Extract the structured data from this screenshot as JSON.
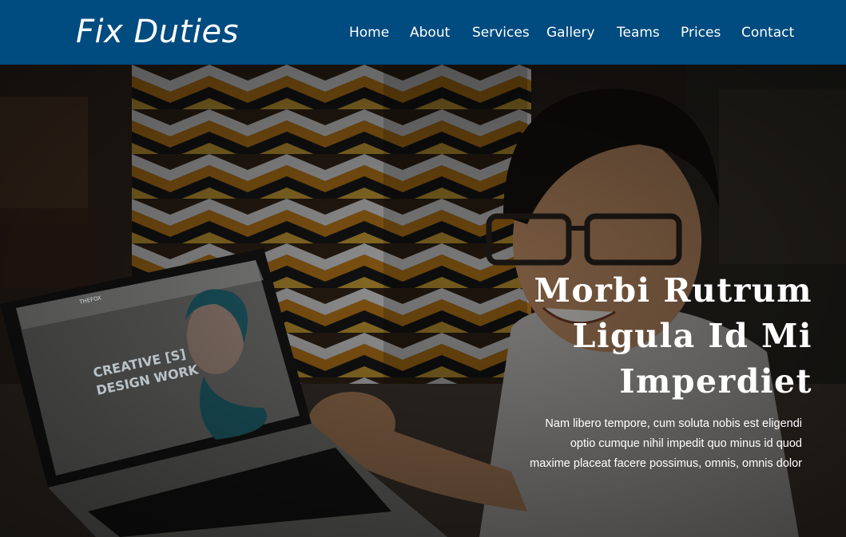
{
  "brand": {
    "name": "Fix Duties"
  },
  "nav": {
    "items": [
      "Home",
      "About",
      "Services",
      "Gallery",
      "Teams",
      "Prices",
      "Contact"
    ]
  },
  "hero": {
    "title_lines": [
      "Morbi Rutrum",
      "Ligula Id Mi",
      "Imperdiet"
    ],
    "subtitle_lines": [
      "Nam libero tempore, cum soluta nobis est eligendi",
      "optio cumque nihil impedit quo minus id quod",
      "maxime placeat facere possimus, omnis, omnis dolor"
    ]
  },
  "laptop_screen": {
    "logo": "THEFOX",
    "headline_1": "CREATIVE [S]",
    "headline_2": "DESIGN WORK"
  },
  "colors": {
    "navbar": "#004b7f",
    "text": "#ffffff"
  }
}
